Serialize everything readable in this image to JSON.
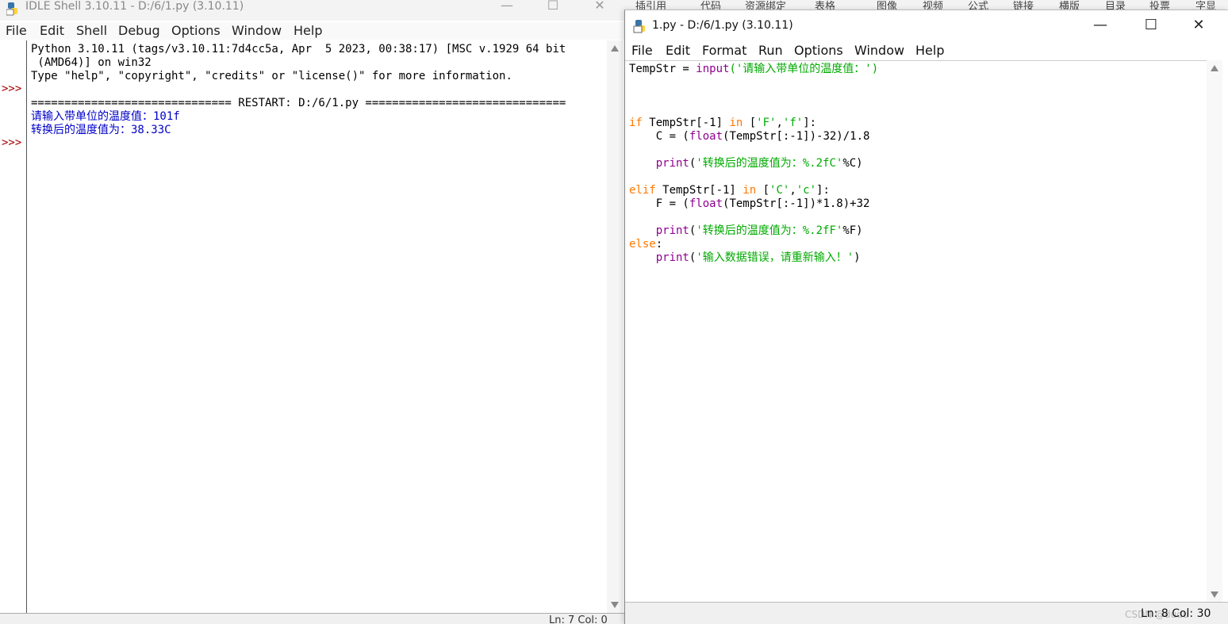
{
  "shell": {
    "title": "IDLE Shell 3.10.11 - D:/6/1.py (3.10.11)",
    "menu": [
      "File",
      "Edit",
      "Shell",
      "Debug",
      "Options",
      "Window",
      "Help"
    ],
    "prompt": ">>>",
    "lines": [
      "Python 3.10.11 (tags/v3.10.11:7d4cc5a, Apr  5 2023, 00:38:17) [MSC v.1929 64 bit",
      " (AMD64)] on win32",
      "Type \"help\", \"copyright\", \"credits\" or \"license()\" for more information.",
      "============================== RESTART: D:/6/1.py =============================="
    ],
    "output": [
      "请输入带单位的温度值：101f",
      "转换后的温度值为：38.33C"
    ],
    "status": "Ln: 7  Col: 0"
  },
  "background_app": {
    "tabs": [
      "插引用",
      "代码",
      "资源绑定",
      "表格",
      "图像",
      "视频",
      "公式",
      "链接",
      "横版",
      "目录",
      "投票",
      "字显"
    ]
  },
  "editor": {
    "title": "1.py - D:/6/1.py (3.10.11)",
    "menu": [
      "File",
      "Edit",
      "Format",
      "Run",
      "Options",
      "Window",
      "Help"
    ],
    "code": {
      "line1": {
        "a": "TempStr = ",
        "b": "input",
        "c": "('请输入带单位的温度值：')"
      },
      "line4": {
        "a": "if",
        "b": " TempStr[-1] ",
        "c": "in",
        "d": " [",
        "e": "'F'",
        "f": ",",
        "g": "'f'",
        "h": "]:"
      },
      "line5": {
        "a": "    C = (",
        "b": "float",
        "c": "(TempStr[:-1])-32)/1.8"
      },
      "line7": {
        "a": "    ",
        "b": "print",
        "c": "(",
        "d": "'转换后的温度值为：%.2fC'",
        "e": "%C)"
      },
      "line9": {
        "a": "elif",
        "b": " TempStr[-1] ",
        "c": "in",
        "d": " [",
        "e": "'C'",
        "f": ",",
        "g": "'c'",
        "h": "]:"
      },
      "line10": {
        "a": "    F = (",
        "b": "float",
        "c": "(TempStr[:-1])*1.8)+32"
      },
      "line12": {
        "a": "    ",
        "b": "print",
        "c": "(",
        "d": "'转换后的温度值为：%.2fF'",
        "e": "%F)"
      },
      "line13": {
        "a": "else",
        "b": ":"
      },
      "line14": {
        "a": "    ",
        "b": "print",
        "c": "(",
        "d": "'输入数据错误，请重新输入！'",
        "e": ")"
      }
    },
    "status": "Ln: 8  Col: 30",
    "watermark": "CSDN @dudu"
  },
  "colors": {
    "keyword": "#ff7700",
    "builtin": "#900090",
    "string": "#00aa00",
    "shell_output": "#0000c8",
    "prompt": "#a60000"
  }
}
